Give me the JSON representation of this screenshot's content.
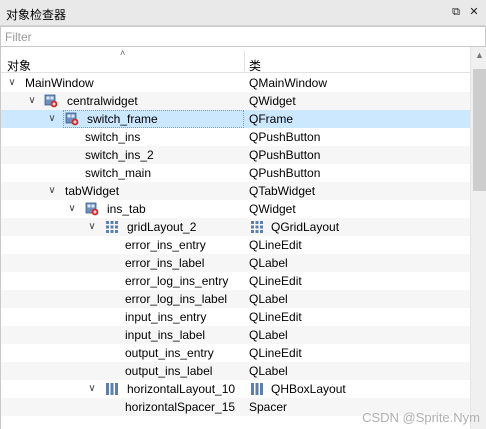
{
  "panel": {
    "title": "对象检查器",
    "float_icon": "restore-icon",
    "close_icon": "close-icon"
  },
  "filter": {
    "placeholder": "Filter",
    "value": ""
  },
  "header": {
    "col_object": "对象",
    "col_class": "类"
  },
  "rows": [
    {
      "name": "MainWindow",
      "class": "QMainWindow",
      "expanded": true,
      "icon": "none"
    },
    {
      "name": "centralwidget",
      "class": "QWidget",
      "expanded": true,
      "icon": "widget-icon"
    },
    {
      "name": "switch_frame",
      "class": "QFrame",
      "expanded": true,
      "icon": "widget-icon",
      "selected": true
    },
    {
      "name": "switch_ins",
      "class": "QPushButton"
    },
    {
      "name": "switch_ins_2",
      "class": "QPushButton"
    },
    {
      "name": "switch_main",
      "class": "QPushButton"
    },
    {
      "name": "tabWidget",
      "class": "QTabWidget",
      "expanded": true,
      "icon": "none"
    },
    {
      "name": "ins_tab",
      "class": "QWidget",
      "expanded": true,
      "icon": "widget-icon"
    },
    {
      "name": "gridLayout_2",
      "class": "QGridLayout",
      "expanded": true,
      "icon": "grid-layout-icon",
      "class_icon": "grid-layout-icon"
    },
    {
      "name": "error_ins_entry",
      "class": "QLineEdit"
    },
    {
      "name": "error_ins_label",
      "class": "QLabel"
    },
    {
      "name": "error_log_ins_entry",
      "class": "QLineEdit"
    },
    {
      "name": "error_log_ins_label",
      "class": "QLabel"
    },
    {
      "name": "input_ins_entry",
      "class": "QLineEdit"
    },
    {
      "name": "input_ins_label",
      "class": "QLabel"
    },
    {
      "name": "output_ins_entry",
      "class": "QLineEdit"
    },
    {
      "name": "output_ins_label",
      "class": "QLabel"
    },
    {
      "name": "horizontalLayout_10",
      "class": "QHBoxLayout",
      "expanded": true,
      "icon": "hbox-layout-icon",
      "class_icon": "hbox-layout-icon"
    },
    {
      "name": "horizontalSpacer_15",
      "class": "Spacer"
    }
  ],
  "watermark": "CSDN @Sprite.Nym",
  "colors": {
    "selection": "#cce8ff",
    "alt_row": "#f6f6f6"
  }
}
